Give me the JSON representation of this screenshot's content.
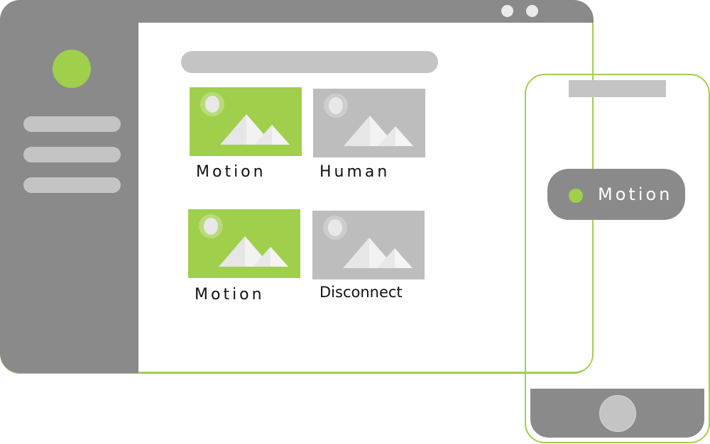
{
  "colors": {
    "accent": "#a0cf4c",
    "frame": "#8a8a8a",
    "placeholder": "#c4c4c4",
    "thumb_active": "#a0cf4c",
    "thumb_inactive": "#bdbdbd"
  },
  "desktop": {
    "window_controls": [
      "circle-button",
      "circle-button"
    ],
    "sidebar": {
      "avatar": "avatar-circle",
      "items": [
        "menu-placeholder",
        "menu-placeholder",
        "menu-placeholder"
      ]
    },
    "search_bar": "search-placeholder",
    "cameras": [
      {
        "label": "Motion",
        "status": "active"
      },
      {
        "label": "Human",
        "status": "inactive"
      },
      {
        "label": "Motion",
        "status": "active"
      },
      {
        "label": "Disconnect",
        "status": "inactive"
      }
    ]
  },
  "phone": {
    "speaker": "speaker-placeholder",
    "notification": {
      "label": "Motion",
      "indicator": "green-dot"
    },
    "home_button": "home-button"
  }
}
